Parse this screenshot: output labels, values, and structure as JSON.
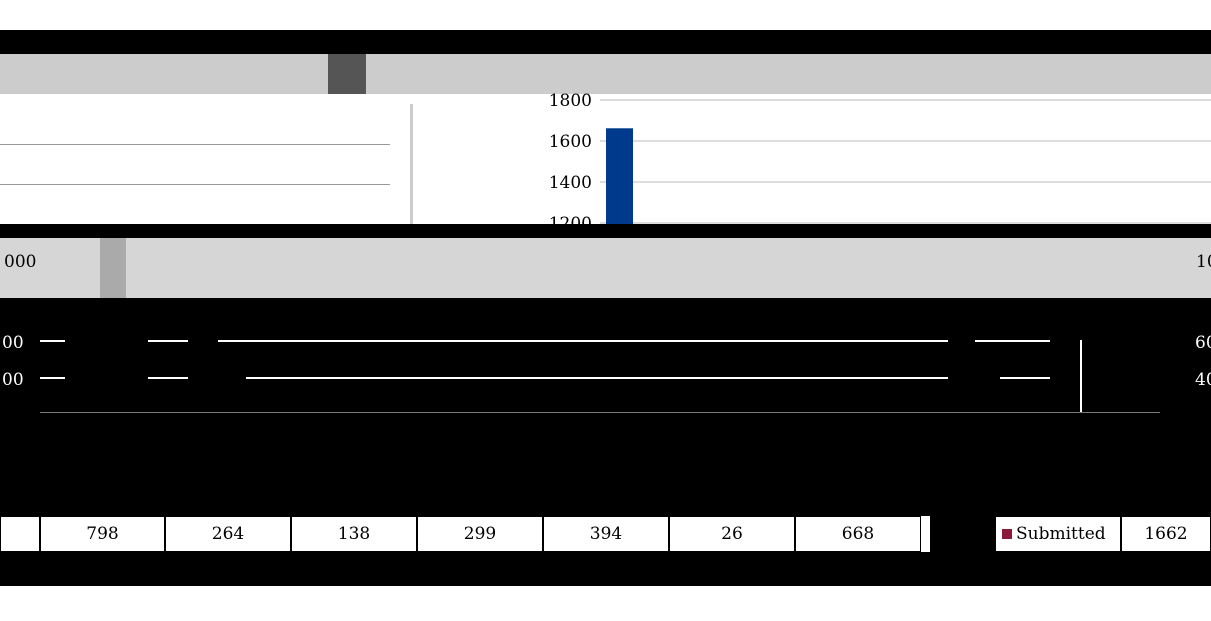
{
  "title": {
    "left": "",
    "right": ""
  },
  "chart_data": {
    "type": "bar",
    "y_ticks": [
      1200,
      1400,
      1600,
      1800
    ],
    "ylim": [
      1200,
      1800
    ],
    "series": [
      {
        "values": [
          1662
        ],
        "color": "#003a8c"
      }
    ],
    "categories": [
      ""
    ],
    "table": {
      "row_values": [
        "798",
        "264",
        "138",
        "299",
        "394",
        "26",
        "668"
      ]
    },
    "legend": {
      "label": "Submitted",
      "value": "1662",
      "color": "#8b1a3a"
    },
    "left_tick_fragments": [
      "000",
      "00",
      "00"
    ],
    "right_tick_fragments": [
      "10",
      "60",
      "40"
    ]
  }
}
